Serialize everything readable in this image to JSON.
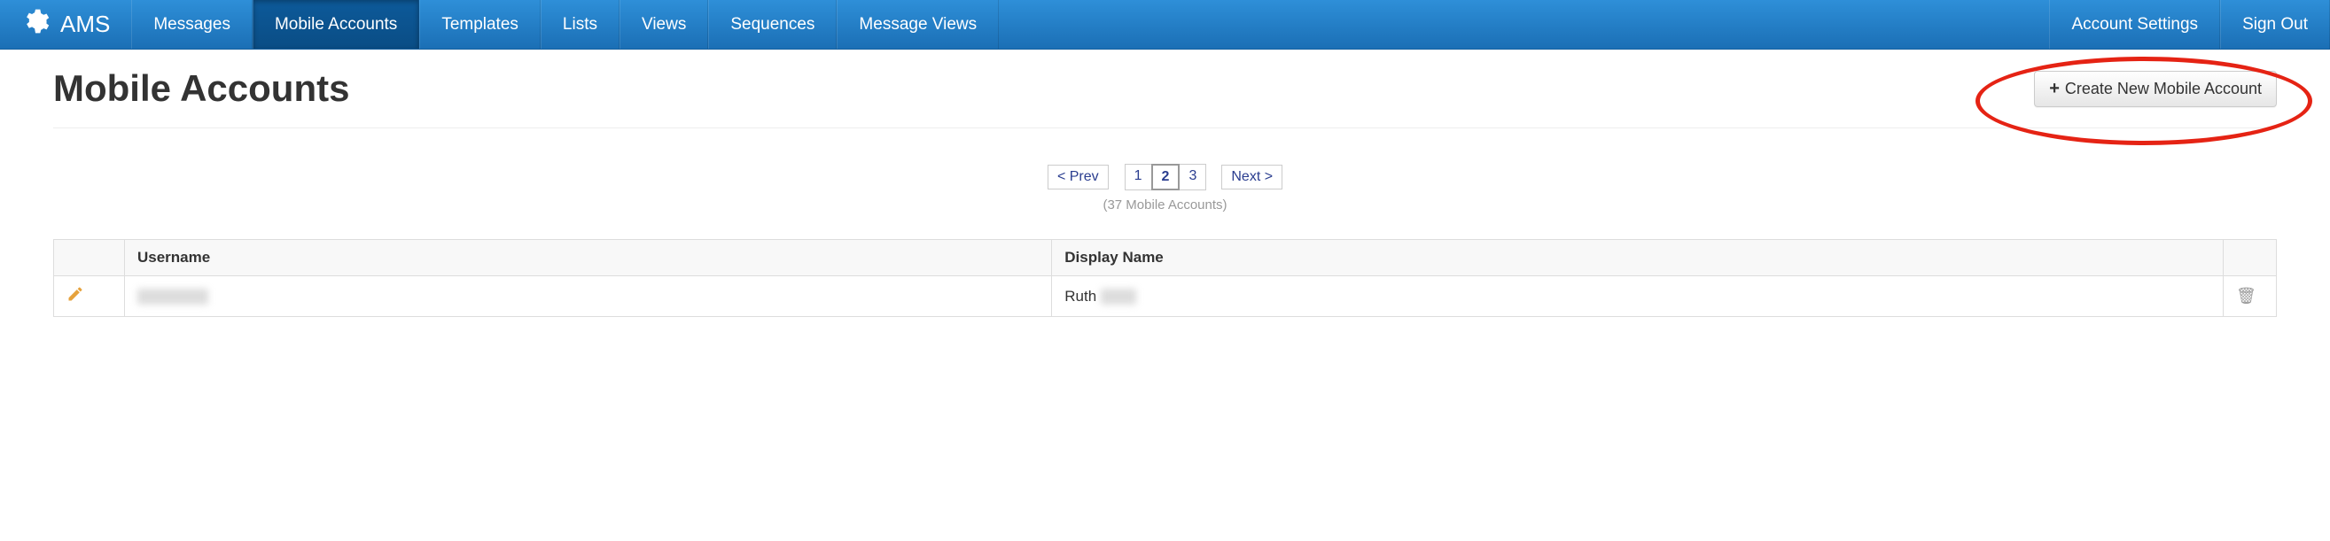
{
  "brand": {
    "name": "AMS"
  },
  "nav": {
    "items": [
      {
        "label": "Messages",
        "active": false
      },
      {
        "label": "Mobile Accounts",
        "active": true
      },
      {
        "label": "Templates",
        "active": false
      },
      {
        "label": "Lists",
        "active": false
      },
      {
        "label": "Views",
        "active": false
      },
      {
        "label": "Sequences",
        "active": false
      },
      {
        "label": "Message Views",
        "active": false
      }
    ],
    "right": [
      {
        "label": "Account Settings"
      },
      {
        "label": "Sign Out"
      }
    ]
  },
  "page": {
    "title": "Mobile Accounts",
    "create_button": "Create New Mobile Account"
  },
  "pagination": {
    "prev": "< Prev",
    "next": "Next >",
    "pages": [
      "1",
      "2",
      "3"
    ],
    "current": "2",
    "count_text": "(37 Mobile Accounts)"
  },
  "table": {
    "headers": {
      "username": "Username",
      "display_name": "Display Name"
    },
    "rows": [
      {
        "username_redacted": true,
        "display_name_prefix": "Ruth",
        "display_name_redacted_suffix": true
      }
    ]
  }
}
